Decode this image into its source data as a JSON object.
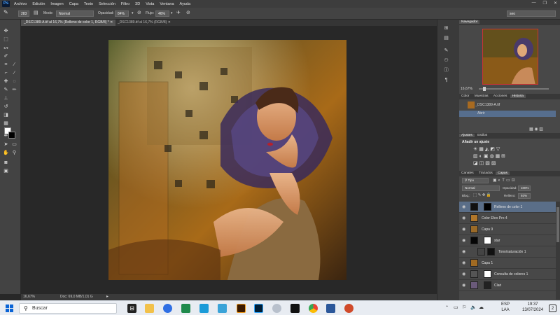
{
  "app": {
    "logo": "Ps"
  },
  "menu": [
    "Archivo",
    "Edición",
    "Imagen",
    "Capa",
    "Texto",
    "Selección",
    "Filtro",
    "3D",
    "Vista",
    "Ventana",
    "Ayuda"
  ],
  "window_controls": [
    "—",
    "❐",
    "✕"
  ],
  "options_bar": {
    "brush_size": "283",
    "mode_label": "Modo:",
    "mode_value": "Normal",
    "opacity_label": "Opacidad:",
    "opacity_value": "84%",
    "flow_label": "Flujo:",
    "flow_value": "46%",
    "workspace": "seo"
  },
  "tabs": [
    {
      "label": "_DSC1389-A.tif al 16,7% (Relleno de color 1, RGB/8) *",
      "active": true
    },
    {
      "label": "_DSC1389.tif al 16,7% (RGB/8)",
      "active": false
    }
  ],
  "status": {
    "zoom": "16,67%",
    "doc": "Doc: 69,0 MB/1,01 G"
  },
  "navigator": {
    "title": "Navegador",
    "zoom": "16,67%"
  },
  "history_panel": {
    "tabs": [
      "Color",
      "Muestras",
      "Acciones",
      "Historia"
    ],
    "active_tab": "Historia",
    "snapshot": "_DSC1389-A.tif",
    "item": "Abrir"
  },
  "adjustments_panel": {
    "tabs": [
      "Ajustes",
      "Estilos"
    ],
    "active_tab": "Ajustes",
    "heading": "Añadir un ajuste"
  },
  "layers_panel": {
    "tabs": [
      "Canales",
      "Trazados",
      "Capas"
    ],
    "active_tab": "Capas",
    "filter": "Tipo",
    "blend_mode": "Normal",
    "opacity_label": "Opacidad:",
    "opacity_value": "100%",
    "lock_label": "Bloq.:",
    "fill_label": "Relleno:",
    "fill_value": "93%",
    "layers": [
      {
        "name": "Relleno de color 1",
        "selected": true
      },
      {
        "name": "Color Efex Pro 4",
        "selected": false
      },
      {
        "name": "Capa 9",
        "selected": false
      },
      {
        "name": "star",
        "selected": false
      },
      {
        "name": "Tono/saturación 1",
        "selected": false
      },
      {
        "name": "Capa 1",
        "selected": false
      },
      {
        "name": "Consulta de colores 1",
        "selected": false
      },
      {
        "name": "Clari",
        "selected": false
      }
    ]
  },
  "taskbar": {
    "search_placeholder": "Buscar",
    "language": "ESP",
    "keyboard": "LAA",
    "time": "19:37",
    "date": "13/07/2024",
    "notifications": "2"
  },
  "colors": {
    "accent": "#4ba3ff",
    "panel": "#484848",
    "canvas_bg": "#282828"
  }
}
